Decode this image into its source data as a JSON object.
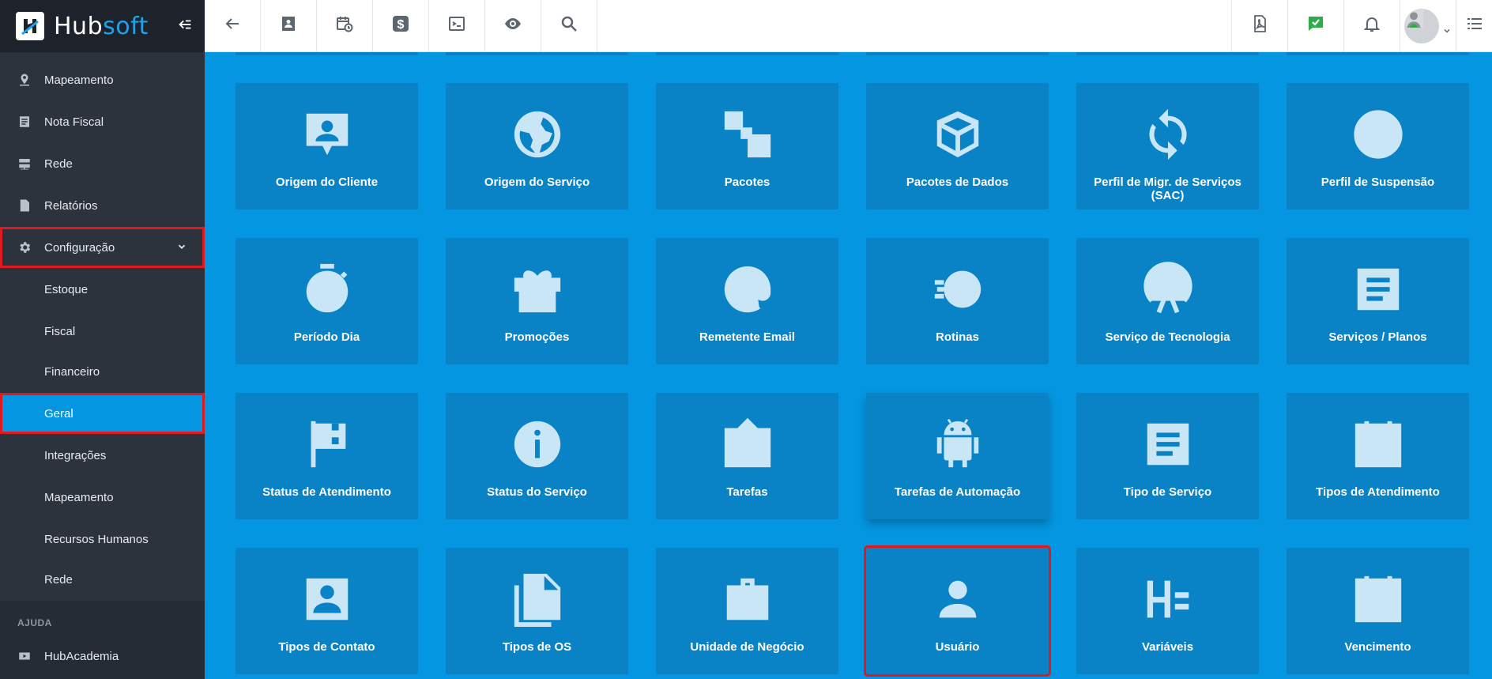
{
  "brand": {
    "name_part1": "Hub",
    "name_part2": "soft"
  },
  "sidebar": {
    "items": [
      {
        "label": "Mapeamento",
        "icon": "map-pin-icon"
      },
      {
        "label": "Nota Fiscal",
        "icon": "receipt-icon"
      },
      {
        "label": "Rede",
        "icon": "server-icon"
      },
      {
        "label": "Relatórios",
        "icon": "document-icon"
      },
      {
        "label": "Configuração",
        "icon": "gear-icon"
      }
    ],
    "subitems": [
      {
        "label": "Estoque"
      },
      {
        "label": "Fiscal"
      },
      {
        "label": "Financeiro"
      },
      {
        "label": "Geral"
      },
      {
        "label": "Integrações"
      },
      {
        "label": "Mapeamento"
      },
      {
        "label": "Recursos Humanos"
      },
      {
        "label": "Rede"
      }
    ],
    "section_help": "AJUDA",
    "help_items": [
      {
        "label": "HubAcademia",
        "icon": "youtube-icon"
      }
    ]
  },
  "topbar": {
    "left_icons": [
      "back-arrow-icon",
      "contact-card-icon",
      "calendar-clock-icon",
      "dollar-icon",
      "terminal-icon",
      "eye-icon",
      "search-icon"
    ],
    "right_icons": [
      "pdf-icon",
      "chat-check-icon",
      "bell-icon",
      "user-avatar",
      "list-menu-icon"
    ]
  },
  "tiles": [
    {
      "label": "Origem do Cliente",
      "icon": "chat-person-icon"
    },
    {
      "label": "Origem do Serviço",
      "icon": "globe-icon"
    },
    {
      "label": "Pacotes",
      "icon": "squares-icon"
    },
    {
      "label": "Pacotes de Dados",
      "icon": "box-icon"
    },
    {
      "label": "Perfil de Migr. de Serviços (SAC)",
      "icon": "sync-icon"
    },
    {
      "label": "Perfil de Suspensão",
      "icon": "block-icon"
    },
    {
      "label": "Período Dia",
      "icon": "stopwatch-icon"
    },
    {
      "label": "Promoções",
      "icon": "gift-icon"
    },
    {
      "label": "Remetente Email",
      "icon": "at-sign-icon"
    },
    {
      "label": "Rotinas",
      "icon": "clock-fast-icon"
    },
    {
      "label": "Serviço de Tecnologia",
      "icon": "antenna-icon"
    },
    {
      "label": "Serviços / Planos",
      "icon": "list-doc-icon"
    },
    {
      "label": "Status de Atendimento",
      "icon": "flag-icon"
    },
    {
      "label": "Status do Serviço",
      "icon": "info-icon"
    },
    {
      "label": "Tarefas",
      "icon": "dashboard-icon"
    },
    {
      "label": "Tarefas de Automação",
      "icon": "android-icon"
    },
    {
      "label": "Tipo de Serviço",
      "icon": "list-doc-icon"
    },
    {
      "label": "Tipos de Atendimento",
      "icon": "calendar-plus-icon"
    },
    {
      "label": "Tipos de Contato",
      "icon": "contact-card-icon"
    },
    {
      "label": "Tipos de OS",
      "icon": "files-icon"
    },
    {
      "label": "Unidade de Negócio",
      "icon": "briefcase-icon"
    },
    {
      "label": "Usuário",
      "icon": "person-icon"
    },
    {
      "label": "Variáveis",
      "icon": "variable-icon"
    },
    {
      "label": "Vencimento",
      "icon": "calendar-event-icon"
    }
  ],
  "colors": {
    "accent": "#0496e0",
    "tile": "#0a82c6",
    "sidebar": "#2c333d",
    "highlight": "#e0181f",
    "chat_green": "#2eac4a"
  }
}
